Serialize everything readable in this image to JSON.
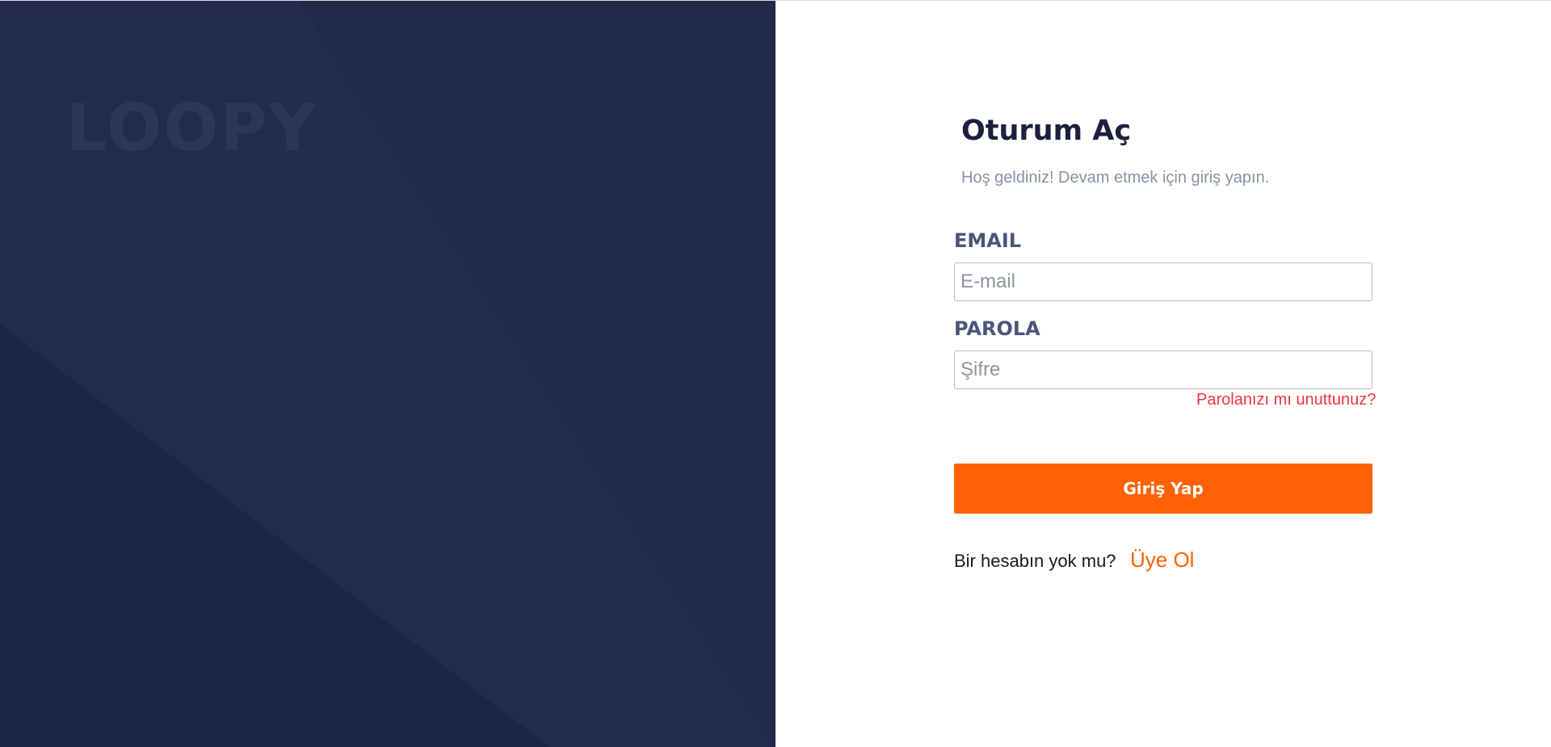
{
  "brand": {
    "logo_text": "LOOPY"
  },
  "login": {
    "title": "Oturum Aç",
    "subtitle": "Hoş geldiniz! Devam etmek için giriş yapın.",
    "email_label": "EMAIL",
    "email_placeholder": "E-mail",
    "email_value": "",
    "password_label": "PAROLA",
    "password_placeholder": "Şifre",
    "password_value": "",
    "forgot_link": "Parolanızı mı unuttunuz?",
    "submit_label": "Giriş Yap",
    "signup_prompt": "Bir hesabın yok mu?",
    "signup_link": "Üye Ol"
  },
  "colors": {
    "panel_background": "#222a4d",
    "accent": "#ff6202",
    "link_red": "#f2343f",
    "title": "#1c1f3d",
    "label": "#4a5577"
  }
}
